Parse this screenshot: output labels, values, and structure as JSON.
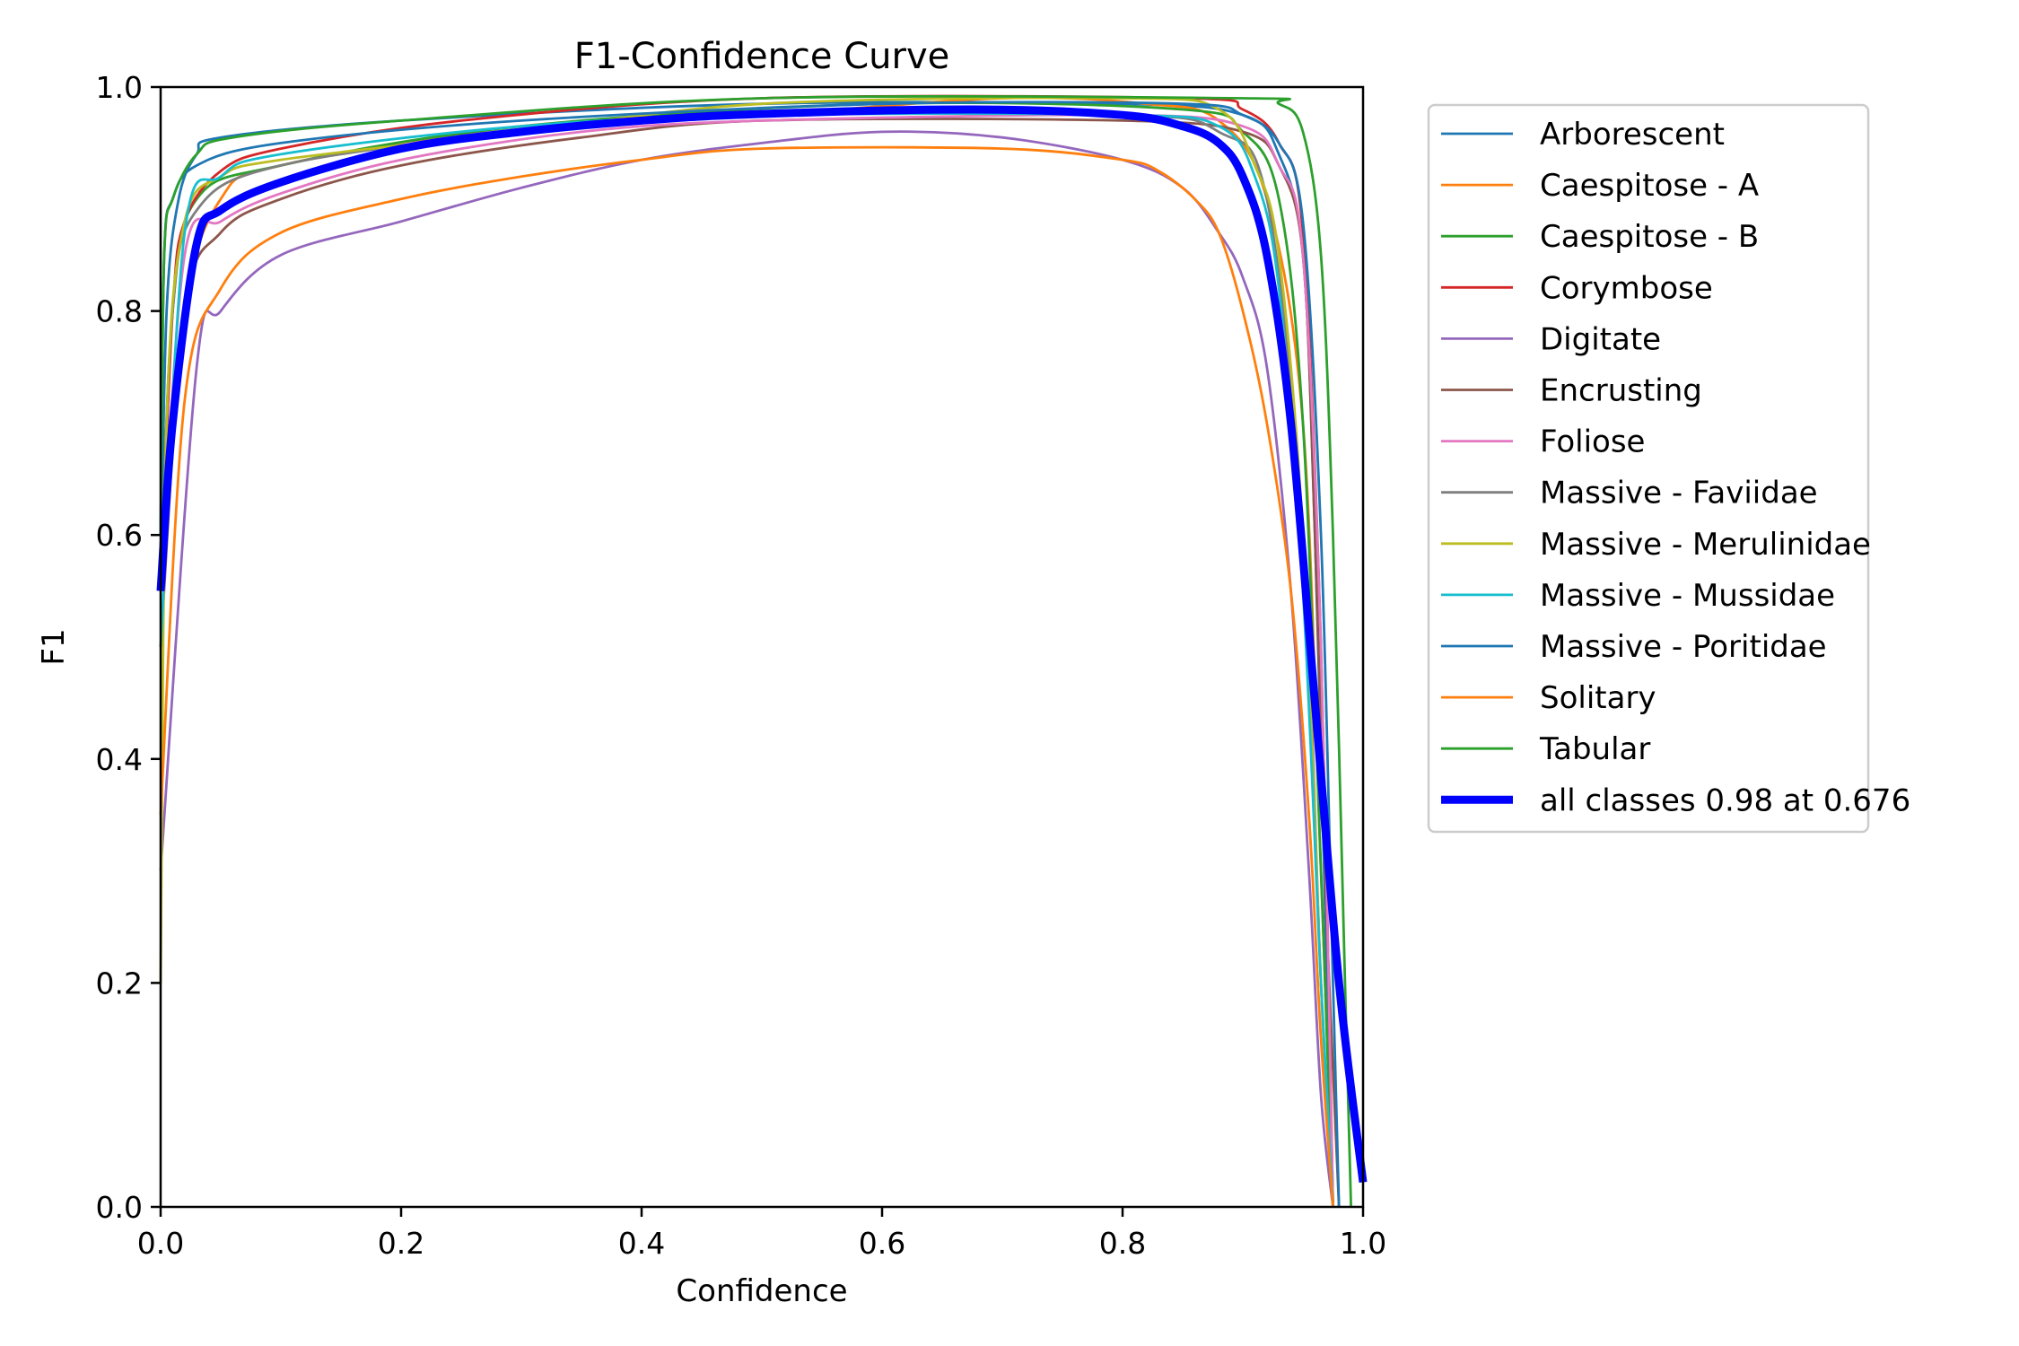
{
  "chart_data": {
    "type": "line",
    "title": "F1-Confidence Curve",
    "xlabel": "Confidence",
    "ylabel": "F1",
    "xlim": [
      0.0,
      1.0
    ],
    "ylim": [
      0.0,
      1.0
    ],
    "xticks": [
      "0.0",
      "0.2",
      "0.4",
      "0.6",
      "0.8",
      "1.0"
    ],
    "yticks": [
      "0.0",
      "0.2",
      "0.4",
      "0.6",
      "0.8",
      "1.0"
    ],
    "grid": false,
    "legend_position": "outside-right-top",
    "series": [
      {
        "name": "Arborescent",
        "color": "#1f77b4",
        "points": [
          [
            0,
            0.55
          ],
          [
            0.005,
            0.8
          ],
          [
            0.015,
            0.9
          ],
          [
            0.03,
            0.94
          ],
          [
            0.05,
            0.955
          ],
          [
            0.2,
            0.97
          ],
          [
            0.5,
            0.985
          ],
          [
            0.8,
            0.985
          ],
          [
            0.9,
            0.975
          ],
          [
            0.93,
            0.94
          ],
          [
            0.95,
            0.85
          ],
          [
            0.96,
            0.6
          ],
          [
            0.97,
            0.2
          ],
          [
            0.975,
            0
          ]
        ]
      },
      {
        "name": "Caespitose - A",
        "color": "#ff7f0e",
        "points": [
          [
            0,
            0.55
          ],
          [
            0.02,
            0.8
          ],
          [
            0.05,
            0.9
          ],
          [
            0.1,
            0.93
          ],
          [
            0.3,
            0.965
          ],
          [
            0.5,
            0.975
          ],
          [
            0.7,
            0.99
          ],
          [
            0.82,
            0.985
          ],
          [
            0.88,
            0.97
          ],
          [
            0.92,
            0.9
          ],
          [
            0.95,
            0.7
          ],
          [
            0.965,
            0.3
          ],
          [
            0.975,
            0
          ]
        ]
      },
      {
        "name": "Caespitose - B",
        "color": "#2ca02c",
        "points": [
          [
            0,
            0.55
          ],
          [
            0.01,
            0.8
          ],
          [
            0.03,
            0.9
          ],
          [
            0.1,
            0.93
          ],
          [
            0.3,
            0.965
          ],
          [
            0.6,
            0.985
          ],
          [
            0.85,
            0.98
          ],
          [
            0.9,
            0.96
          ],
          [
            0.93,
            0.9
          ],
          [
            0.95,
            0.7
          ],
          [
            0.965,
            0.3
          ],
          [
            0.975,
            0
          ]
        ]
      },
      {
        "name": "Corymbose",
        "color": "#d62728",
        "points": [
          [
            0,
            0.55
          ],
          [
            0.01,
            0.8
          ],
          [
            0.02,
            0.88
          ],
          [
            0.05,
            0.925
          ],
          [
            0.1,
            0.945
          ],
          [
            0.25,
            0.97
          ],
          [
            0.5,
            0.99
          ],
          [
            0.85,
            0.99
          ],
          [
            0.9,
            0.98
          ],
          [
            0.93,
            0.95
          ],
          [
            0.95,
            0.87
          ],
          [
            0.965,
            0.5
          ],
          [
            0.975,
            0
          ]
        ]
      },
      {
        "name": "Digitate",
        "color": "#9467bd",
        "points": [
          [
            0,
            0.3
          ],
          [
            0.03,
            0.75
          ],
          [
            0.05,
            0.8
          ],
          [
            0.1,
            0.85
          ],
          [
            0.2,
            0.88
          ],
          [
            0.3,
            0.91
          ],
          [
            0.4,
            0.935
          ],
          [
            0.5,
            0.95
          ],
          [
            0.6,
            0.96
          ],
          [
            0.7,
            0.955
          ],
          [
            0.8,
            0.935
          ],
          [
            0.85,
            0.91
          ],
          [
            0.88,
            0.87
          ],
          [
            0.9,
            0.83
          ],
          [
            0.92,
            0.75
          ],
          [
            0.94,
            0.55
          ],
          [
            0.955,
            0.3
          ],
          [
            0.965,
            0.1
          ],
          [
            0.975,
            0
          ]
        ]
      },
      {
        "name": "Encrusting",
        "color": "#8c564b",
        "points": [
          [
            0,
            0.5
          ],
          [
            0.02,
            0.8
          ],
          [
            0.05,
            0.87
          ],
          [
            0.1,
            0.9
          ],
          [
            0.2,
            0.93
          ],
          [
            0.35,
            0.955
          ],
          [
            0.5,
            0.97
          ],
          [
            0.8,
            0.97
          ],
          [
            0.9,
            0.96
          ],
          [
            0.93,
            0.93
          ],
          [
            0.95,
            0.85
          ],
          [
            0.96,
            0.6
          ],
          [
            0.97,
            0.25
          ],
          [
            0.98,
            0
          ]
        ]
      },
      {
        "name": "Foliose",
        "color": "#e377c2",
        "points": [
          [
            0,
            0.55
          ],
          [
            0.02,
            0.85
          ],
          [
            0.05,
            0.88
          ],
          [
            0.1,
            0.905
          ],
          [
            0.2,
            0.935
          ],
          [
            0.35,
            0.96
          ],
          [
            0.5,
            0.97
          ],
          [
            0.8,
            0.975
          ],
          [
            0.9,
            0.965
          ],
          [
            0.93,
            0.93
          ],
          [
            0.95,
            0.85
          ],
          [
            0.965,
            0.5
          ],
          [
            0.975,
            0
          ]
        ]
      },
      {
        "name": "Massive - Faviidae",
        "color": "#7f7f7f",
        "points": [
          [
            0,
            0.55
          ],
          [
            0.01,
            0.8
          ],
          [
            0.03,
            0.89
          ],
          [
            0.1,
            0.93
          ],
          [
            0.3,
            0.96
          ],
          [
            0.5,
            0.975
          ],
          [
            0.8,
            0.975
          ],
          [
            0.88,
            0.96
          ],
          [
            0.92,
            0.9
          ],
          [
            0.95,
            0.6
          ],
          [
            0.965,
            0.2
          ],
          [
            0.975,
            0
          ]
        ]
      },
      {
        "name": "Massive - Merulinidae",
        "color": "#bcbd22",
        "points": [
          [
            0,
            0.2
          ],
          [
            0.005,
            0.7
          ],
          [
            0.02,
            0.88
          ],
          [
            0.05,
            0.92
          ],
          [
            0.1,
            0.935
          ],
          [
            0.3,
            0.96
          ],
          [
            0.5,
            0.985
          ],
          [
            0.8,
            0.99
          ],
          [
            0.88,
            0.98
          ],
          [
            0.91,
            0.93
          ],
          [
            0.93,
            0.85
          ],
          [
            0.95,
            0.6
          ],
          [
            0.965,
            0.2
          ],
          [
            0.975,
            0
          ]
        ]
      },
      {
        "name": "Massive - Mussidae",
        "color": "#17becf",
        "points": [
          [
            0,
            0.5
          ],
          [
            0.02,
            0.87
          ],
          [
            0.05,
            0.92
          ],
          [
            0.1,
            0.94
          ],
          [
            0.3,
            0.965
          ],
          [
            0.5,
            0.975
          ],
          [
            0.8,
            0.975
          ],
          [
            0.88,
            0.965
          ],
          [
            0.91,
            0.92
          ],
          [
            0.93,
            0.82
          ],
          [
            0.95,
            0.55
          ],
          [
            0.965,
            0.2
          ],
          [
            0.975,
            0
          ]
        ]
      },
      {
        "name": "Massive - Poritidae",
        "color": "#1f77b4",
        "points": [
          [
            0,
            0.6
          ],
          [
            0.003,
            0.85
          ],
          [
            0.01,
            0.9
          ],
          [
            0.03,
            0.93
          ],
          [
            0.1,
            0.95
          ],
          [
            0.3,
            0.97
          ],
          [
            0.6,
            0.985
          ],
          [
            0.85,
            0.985
          ],
          [
            0.9,
            0.975
          ],
          [
            0.93,
            0.95
          ],
          [
            0.95,
            0.88
          ],
          [
            0.965,
            0.6
          ],
          [
            0.975,
            0.2
          ],
          [
            0.98,
            0
          ]
        ]
      },
      {
        "name": "Solitary",
        "color": "#ff7f0e",
        "points": [
          [
            0,
            0.35
          ],
          [
            0.02,
            0.72
          ],
          [
            0.05,
            0.82
          ],
          [
            0.1,
            0.87
          ],
          [
            0.2,
            0.9
          ],
          [
            0.3,
            0.92
          ],
          [
            0.4,
            0.935
          ],
          [
            0.5,
            0.945
          ],
          [
            0.7,
            0.945
          ],
          [
            0.8,
            0.935
          ],
          [
            0.83,
            0.925
          ],
          [
            0.86,
            0.9
          ],
          [
            0.88,
            0.87
          ],
          [
            0.9,
            0.8
          ],
          [
            0.92,
            0.7
          ],
          [
            0.94,
            0.55
          ],
          [
            0.955,
            0.35
          ],
          [
            0.965,
            0.15
          ],
          [
            0.975,
            0
          ]
        ]
      },
      {
        "name": "Tabular",
        "color": "#2ca02c",
        "points": [
          [
            0,
            0.6
          ],
          [
            0.003,
            0.85
          ],
          [
            0.01,
            0.9
          ],
          [
            0.03,
            0.94
          ],
          [
            0.06,
            0.955
          ],
          [
            0.2,
            0.97
          ],
          [
            0.5,
            0.99
          ],
          [
            0.9,
            0.99
          ],
          [
            0.93,
            0.985
          ],
          [
            0.95,
            0.96
          ],
          [
            0.965,
            0.85
          ],
          [
            0.975,
            0.6
          ],
          [
            0.985,
            0.2
          ],
          [
            0.99,
            0
          ]
        ]
      },
      {
        "name": "all classes 0.98 at 0.676",
        "color": "#0000ff",
        "bold": true,
        "points": [
          [
            0,
            0.55
          ],
          [
            0.01,
            0.7
          ],
          [
            0.03,
            0.86
          ],
          [
            0.05,
            0.89
          ],
          [
            0.1,
            0.915
          ],
          [
            0.2,
            0.945
          ],
          [
            0.3,
            0.96
          ],
          [
            0.4,
            0.97
          ],
          [
            0.5,
            0.976
          ],
          [
            0.676,
            0.98
          ],
          [
            0.8,
            0.975
          ],
          [
            0.85,
            0.965
          ],
          [
            0.88,
            0.95
          ],
          [
            0.9,
            0.92
          ],
          [
            0.92,
            0.85
          ],
          [
            0.94,
            0.7
          ],
          [
            0.96,
            0.45
          ],
          [
            0.98,
            0.2
          ],
          [
            1.0,
            0.022
          ]
        ]
      }
    ],
    "summary": {
      "best_f1": 0.98,
      "at_confidence": 0.676
    }
  }
}
